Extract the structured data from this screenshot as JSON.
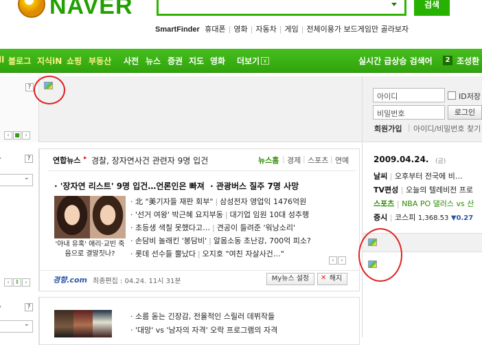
{
  "header": {
    "logo_text": "NAVER",
    "search_button": "검색",
    "smartfinder": "SmartFinder",
    "topnav": [
      "휴대폰",
      "영화",
      "자동차",
      "게임",
      "전체이용가 보드게임만 골라보자"
    ]
  },
  "greenbar": {
    "yellow_items": [
      "블로그",
      "지식iN",
      "쇼핑",
      "부동산"
    ],
    "white_items": [
      "사전",
      "뉴스",
      "증권",
      "지도",
      "영화"
    ],
    "more": "더보기",
    "realtime": "실시간 급상승 검색어",
    "rank": "2",
    "rank_term": "조성환"
  },
  "login": {
    "id_placeholder": "아이디",
    "id_save": "ID저장",
    "pw_placeholder": "비밀번호",
    "login_button": "로그인",
    "join": "회원가입",
    "find": "아이디/비밀번호 찾기"
  },
  "news": {
    "source": "연합뉴스",
    "top_headline": "경찰, 장자연사건 관련자 9명 입건",
    "tabs": [
      "뉴스홈",
      "경제",
      "스포츠",
      "연예"
    ],
    "main_headline_a": "'장자연 리스트' 9명 입건…언론인은 빠져",
    "main_headline_b": "관광버스 질주 7명 사망",
    "photo_caption": "'아내 유혹' 애리·교빈 죽음으로 결말짓나?",
    "items": [
      [
        "北 \"美기자들 재판 회부\"",
        "삼성전자 영업익 1476억원"
      ],
      [
        "'선거 여왕' 박근혜 요지부동",
        "대기업 임원 10대 성추행"
      ],
      [
        "초등생 색칠 못했다고…",
        "견공이 들려준 '워낭소리'"
      ],
      [
        "손담비 놀래킨 '봉담비'",
        "알몸소동 초난강, 700억 피소?"
      ],
      [
        "롯데 선수들 뿔났다",
        "오지호 \"여친 자살사건…\""
      ]
    ],
    "footer_logo": "경향.com",
    "updated": "최종편집 : 04.24. 11시 31분",
    "mynews_button": "My뉴스 설정",
    "unsubscribe_button": "해지"
  },
  "news2": {
    "items": [
      "소름 돋는 긴장감, 전율적인 스릴러 데뷔작들",
      "'대망' vs '남자의 자격' 오락 프로그램의 자격"
    ]
  },
  "right": {
    "date": "2009.04.24.",
    "day": "(금)",
    "rows": [
      {
        "label": "날씨",
        "text": "오후부터 전국에 비…"
      },
      {
        "label": "TV편성",
        "text": "오늘의 텔레비전 프로"
      },
      {
        "label": "스포츠",
        "text": "NBA PO 댈러스 vs 산"
      },
      {
        "label": "증시",
        "text": "코스피",
        "value": "1,368.53",
        "change": "▼0.27"
      }
    ]
  },
  "colors": {
    "brand_green": "#2eb400",
    "link_blue": "#2a55a6",
    "sports_green": "#2a8a00",
    "highlight_red": "#e02020"
  }
}
